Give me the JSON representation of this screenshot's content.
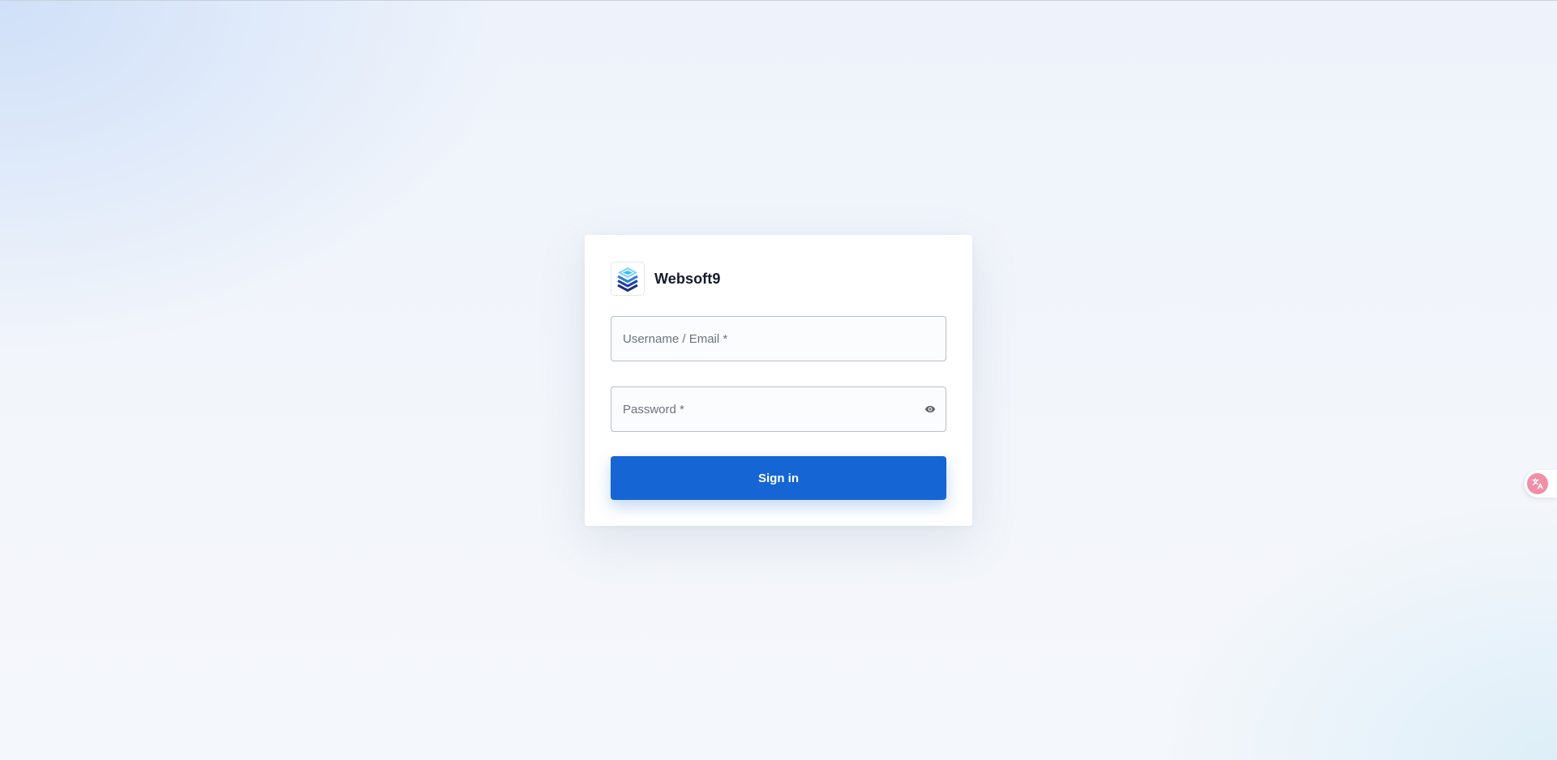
{
  "app": {
    "brand_name": "Websoft9",
    "logo_icon": "stacked-layers-logo-icon"
  },
  "login_form": {
    "username_placeholder": "Username / Email *",
    "username_value": "",
    "password_placeholder": "Password *",
    "password_value": "",
    "password_toggle_icon": "eye-icon",
    "submit_label": "Sign in"
  },
  "translate_widget": {
    "icon": "translate-icon"
  },
  "colors": {
    "primary": "#1565d4",
    "logo_light": "#38bdf8",
    "logo_dark": "#1e3a8a",
    "translate": "#ef8fa8"
  }
}
